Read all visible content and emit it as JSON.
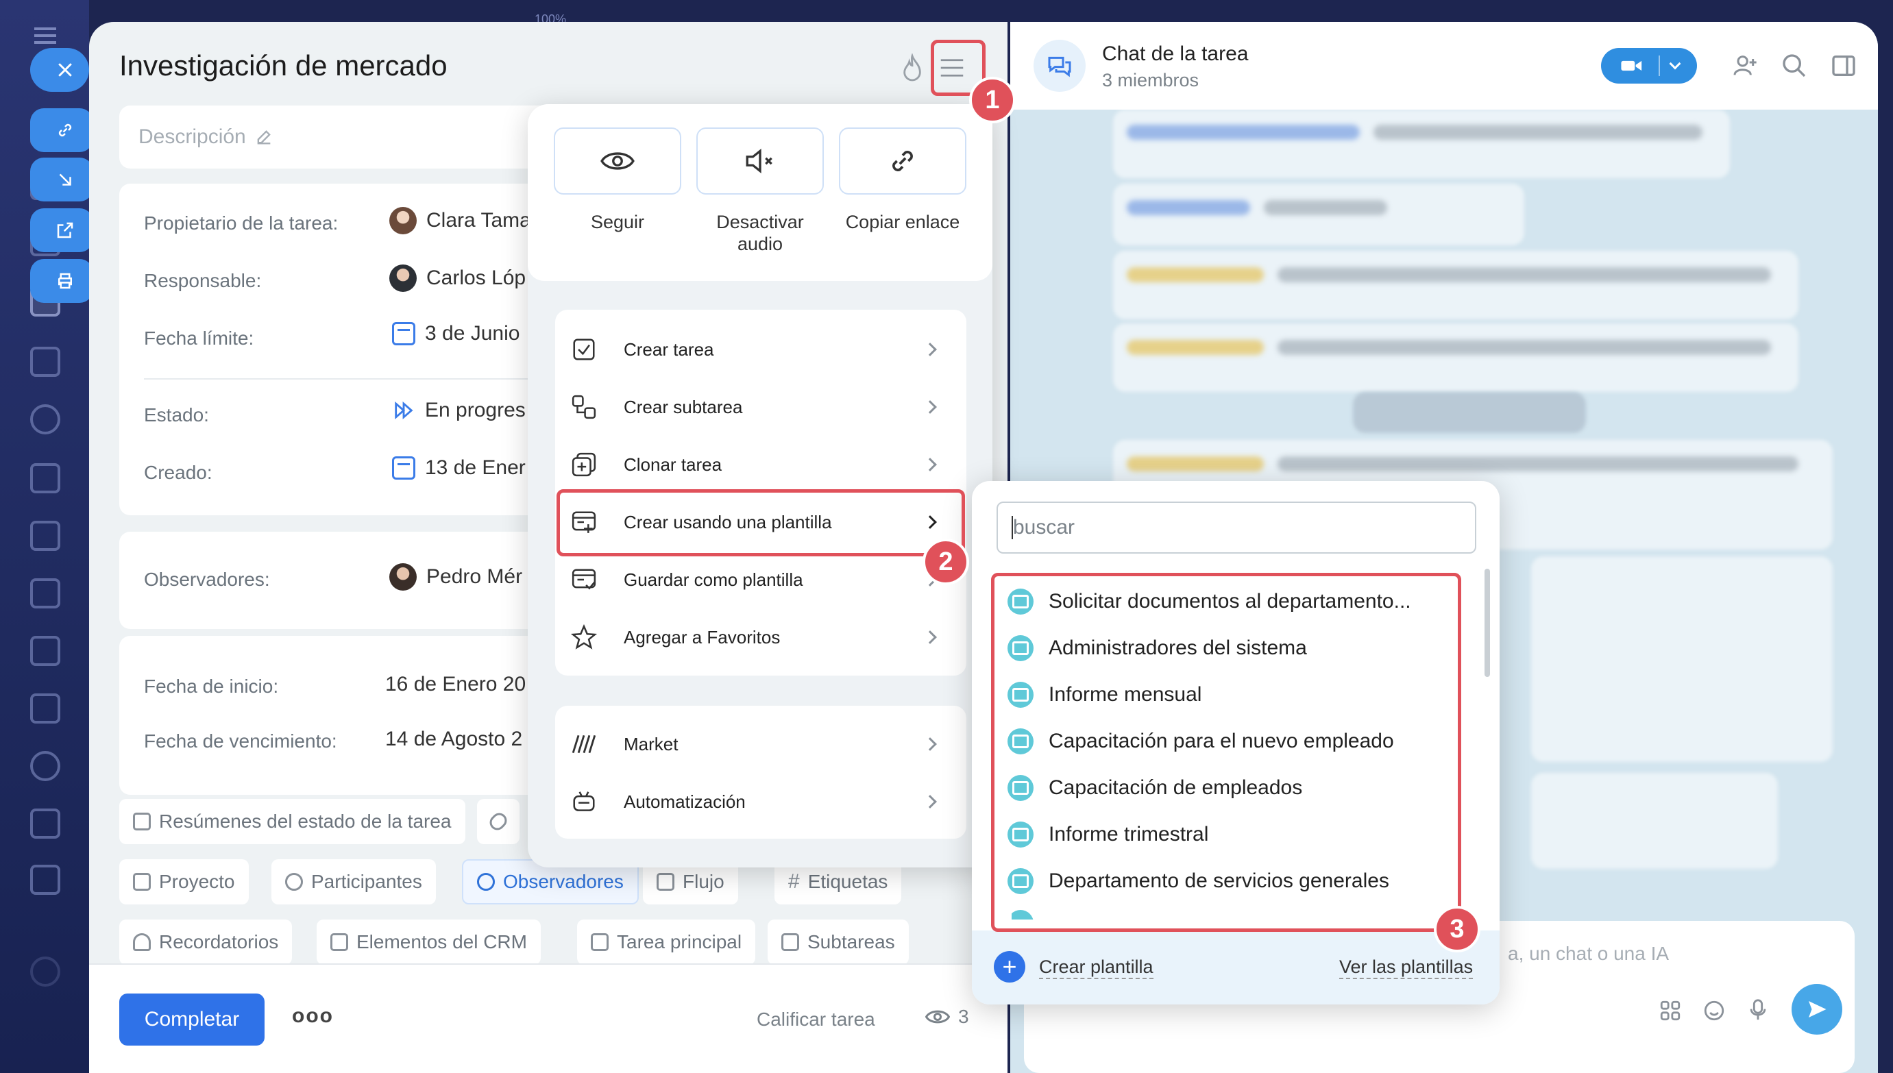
{
  "task": {
    "title": "Investigación de mercado",
    "description_placeholder": "Descripción",
    "owner_label": "Propietario de la tarea:",
    "owner_value": "Clara Tama",
    "responsible_label": "Responsable:",
    "responsible_value": "Carlos Lóp",
    "deadline_label": "Fecha límite:",
    "deadline_value": "3 de Junio",
    "status_label": "Estado:",
    "status_value": "En progres",
    "created_label": "Creado:",
    "created_value": "13 de Ener",
    "observers_label": "Observadores:",
    "observers_value": "Pedro Mér",
    "start_label": "Fecha de inicio:",
    "start_value": "16 de Enero 20",
    "due_label": "Fecha de vencimiento:",
    "due_value": "14 de Agosto 2",
    "chips": {
      "summaries": "Resúmenes del estado de la tarea",
      "project": "Proyecto",
      "participants": "Participantes",
      "observers": "Observadores",
      "flow": "Flujo",
      "tags": "Etiquetas",
      "reminders": "Recordatorios",
      "crm": "Elementos del CRM",
      "parent": "Tarea principal",
      "subtasks": "Subtareas"
    },
    "complete_button": "Completar",
    "more_button": "ooo",
    "rate_task": "Calificar tarea",
    "views_count": "3"
  },
  "sidebar": {
    "zoom_label": "100%"
  },
  "menu": {
    "follow": "Seguir",
    "mute": "Desactivar audio",
    "copy_link": "Copiar enlace",
    "items": [
      "Crear tarea",
      "Crear subtarea",
      "Clonar tarea",
      "Crear usando una plantilla",
      "Guardar como plantilla",
      "Agregar a Favoritos",
      "Market",
      "Automatización"
    ]
  },
  "templates": {
    "search_placeholder": "buscar",
    "items": [
      "Solicitar documentos al departamento...",
      "Administradores del sistema",
      "Informe mensual",
      "Capacitación para el nuevo empleado",
      "Capacitación de empleados",
      "Informe trimestral",
      "Departamento de servicios generales"
    ],
    "create_link": "Crear plantilla",
    "view_link": "Ver las plantillas"
  },
  "chat": {
    "title": "Chat de la tarea",
    "members": "3 miembros",
    "input_partial": "a, un chat o una IA"
  },
  "badges": [
    "1",
    "2",
    "3"
  ],
  "colors": {
    "accent": "#3b7ce8",
    "highlight": "#e0515a",
    "template_icon": "#5fc9d8"
  }
}
